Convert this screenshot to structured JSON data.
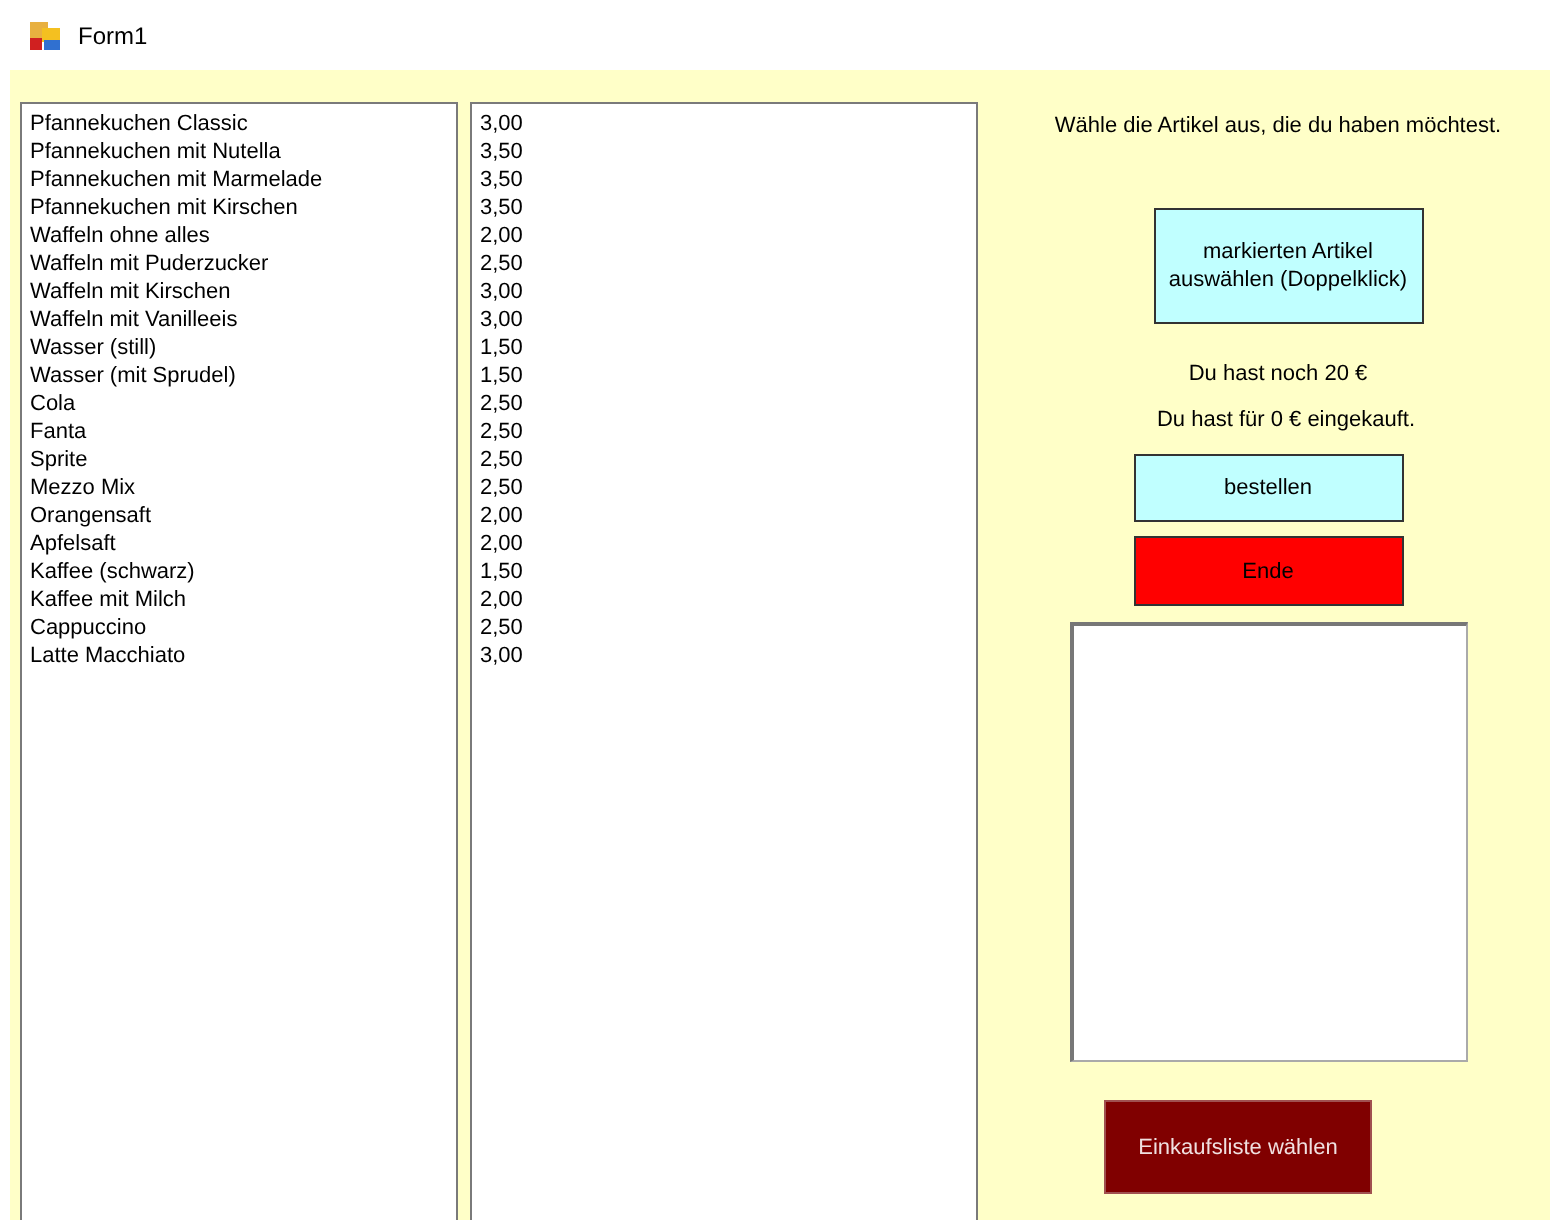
{
  "window": {
    "title": "Form1"
  },
  "products": [
    "Pfannekuchen Classic",
    "Pfannekuchen mit Nutella",
    "Pfannekuchen mit Marmelade",
    "Pfannekuchen mit Kirschen",
    "Waffeln ohne alles",
    "Waffeln mit Puderzucker",
    "Waffeln mit Kirschen",
    "Waffeln mit Vanilleeis",
    "Wasser (still)",
    "Wasser (mit Sprudel)",
    "Cola",
    "Fanta",
    "Sprite",
    "Mezzo Mix",
    "Orangensaft",
    "Apfelsaft",
    "Kaffee (schwarz)",
    "Kaffee mit Milch",
    "Cappuccino",
    "Latte Macchiato"
  ],
  "prices": [
    "3,00",
    "3,50",
    "3,50",
    "3,50",
    "2,00",
    "2,50",
    "3,00",
    "3,00",
    "1,50",
    "1,50",
    "2,50",
    "2,50",
    "2,50",
    "2,50",
    "2,00",
    "2,00",
    "1,50",
    "2,00",
    "2,50",
    "3,00"
  ],
  "instruction": "Wähle die Artikel aus, die du haben möchtest.",
  "select_button": "markierten Artikel auswählen (Doppelklick)",
  "balance": "Du hast noch 20 €",
  "spent": "Du hast für 0 € eingekauft.",
  "order_button": "bestellen",
  "end_button": "Ende",
  "list_button": "Einkaufsliste wählen"
}
